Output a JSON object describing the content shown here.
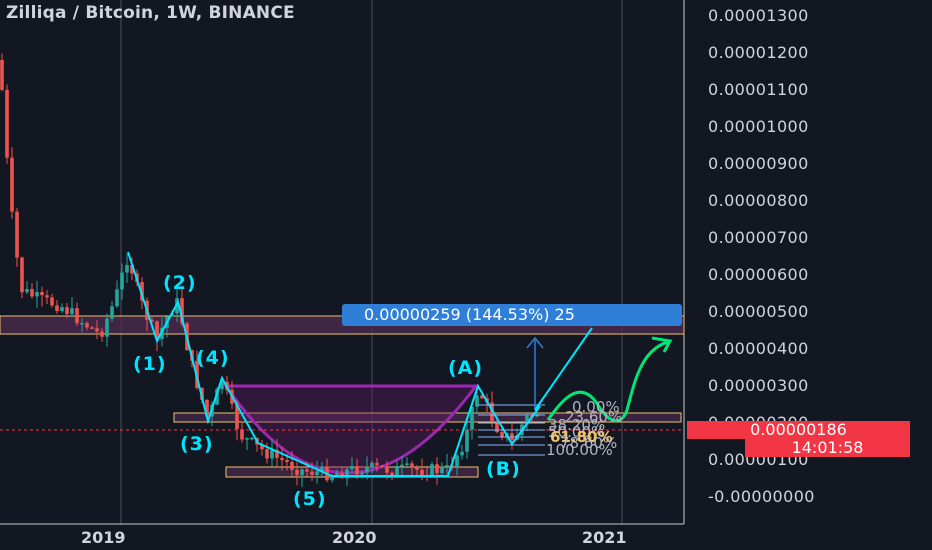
{
  "chart_data": {
    "type": "candlestick",
    "title": "Zilliqa / Bitcoin, 1W, BINANCE",
    "y_ticks": [
      "0.00001300",
      "0.00001200",
      "0.00001100",
      "0.00001000",
      "0.00000900",
      "0.00000800",
      "0.00000700",
      "0.00000600",
      "0.00000500",
      "0.00000400",
      "0.00000300",
      "0.00000200",
      "0.00000100",
      "-0.00000000"
    ],
    "x_ticks": [
      "2019",
      "2020",
      "2021"
    ],
    "ylim": [
      -1e-07,
      1.32e-05
    ],
    "last_price": "0.00000186",
    "countdown": "14:01:58",
    "measurement": "0.00000259 (144.53%) 25",
    "wave_labels": [
      "(1)",
      "(2)",
      "(3)",
      "(4)",
      "(5)",
      "(A)",
      "(B)"
    ],
    "fib_labels": [
      "0.00%",
      "23.60%",
      "38.20%",
      "50.00%",
      "61.80%",
      "78.60%",
      "100.00%"
    ],
    "colors": {
      "background": "#131722",
      "up": "#26a69a",
      "down": "#ef5350",
      "wave": "#00e5ff",
      "cup": "#9c27b0",
      "zone": "#f0c36b",
      "fib": "#8ab4f8",
      "green_path": "#00e676"
    }
  }
}
